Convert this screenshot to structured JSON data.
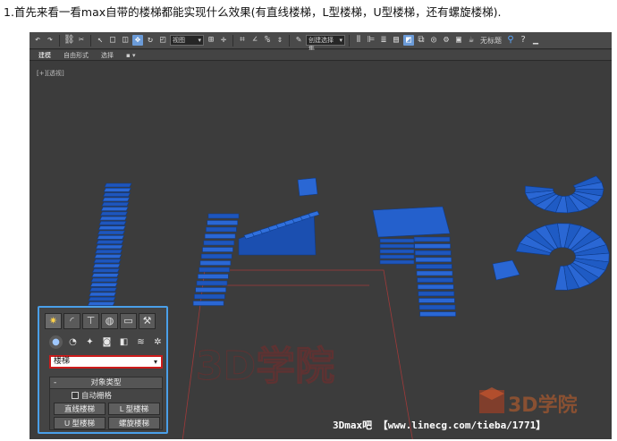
{
  "caption": "1.首先来看一看max自带的楼梯都能实现什么效果(有直线楼梯，L型楼梯，U型楼梯，还有螺旋楼梯).",
  "toolbar": {
    "view_dropdown": "视图",
    "selection_dropdown": "创建选择集",
    "right_label": "无标题"
  },
  "ribbon": {
    "tabs": [
      "建模",
      "自由形式",
      "选择",
      "▪ ▾"
    ]
  },
  "viewport": {
    "label": "[+][透视]",
    "scene_watermark": "3D学院"
  },
  "command_panel": {
    "tab_icons": [
      "create-icon",
      "modify-icon",
      "hierarchy-icon",
      "motion-icon",
      "display-icon",
      "utilities-icon"
    ],
    "subcategory_icons": [
      "geometry-icon",
      "shapes-icon",
      "lights-icon",
      "cameras-icon",
      "helpers-icon",
      "space-warps-icon",
      "systems-icon"
    ],
    "category_select": "楼梯",
    "rollout_title": "对象类型",
    "autogrid_label": "自动栅格",
    "buttons": [
      "直线楼梯",
      "L 型楼梯",
      "U 型楼梯",
      "螺旋楼梯"
    ]
  },
  "footer": {
    "watermark": "3Dmax吧 【www.linecg.com/tieba/1771】",
    "logo_text": "3D学院"
  },
  "colors": {
    "viewport_bg": "#3c3c3c",
    "stair_blue": "#1f5bc4",
    "panel_border": "#4a9fe8",
    "select_border": "#cc1b1b"
  }
}
